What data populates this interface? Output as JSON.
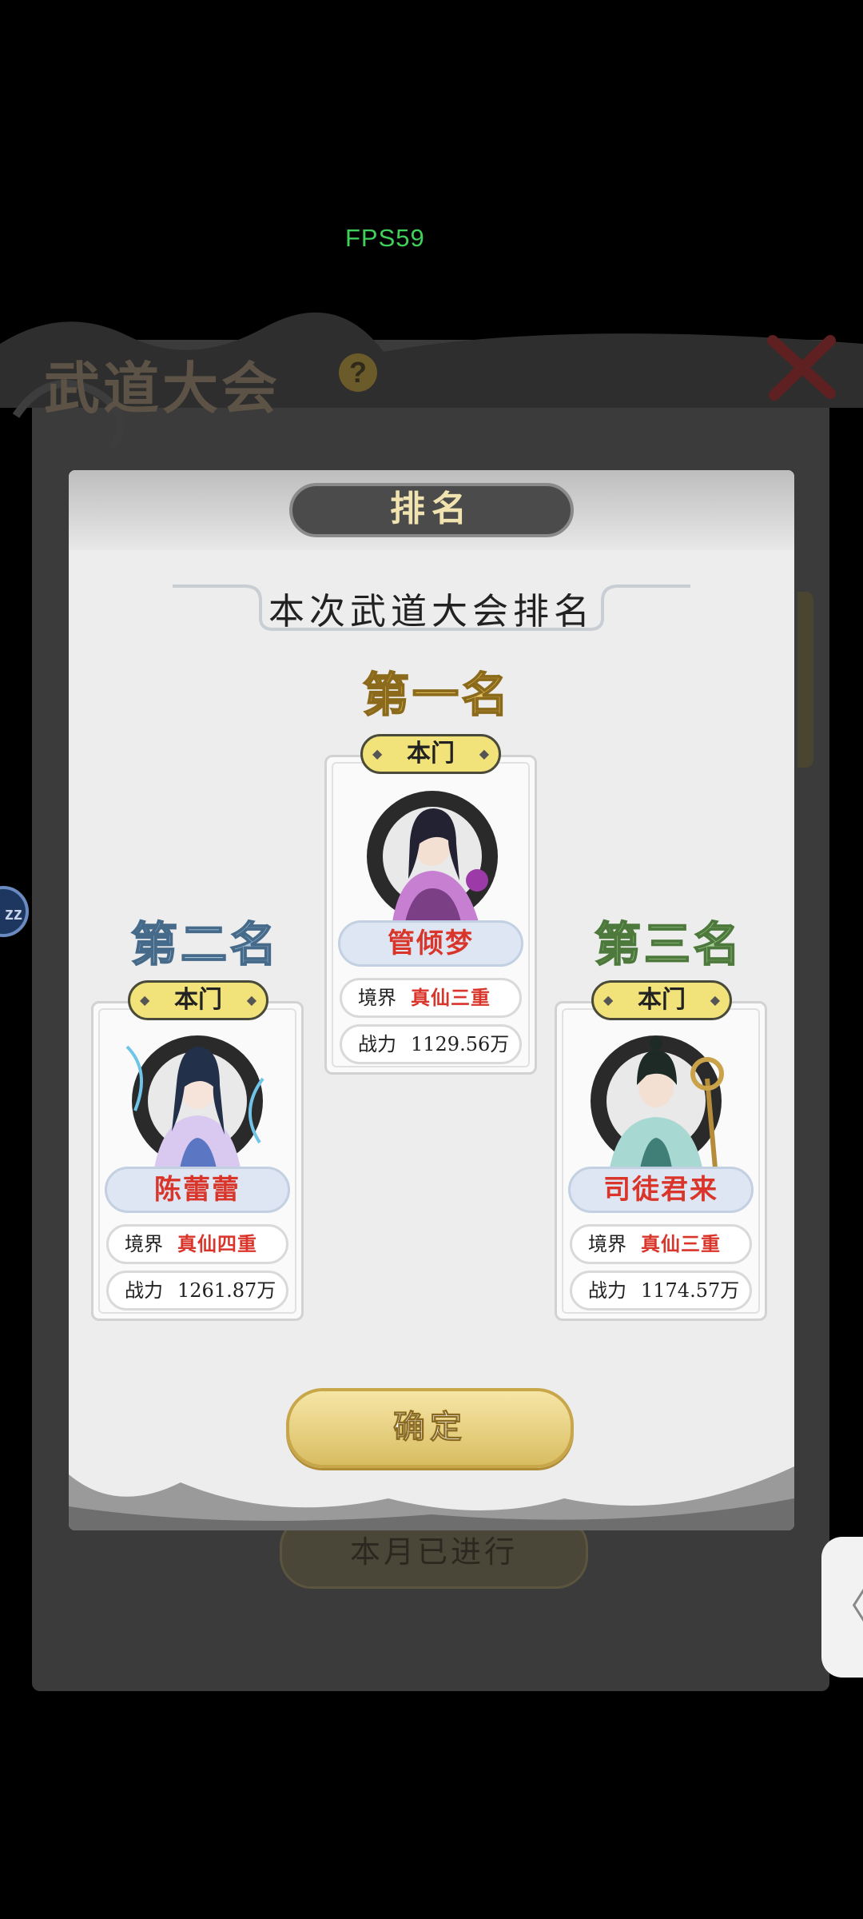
{
  "overlay": {
    "fps": "FPS59"
  },
  "background": {
    "title": "武道大会",
    "help_icon": "?",
    "month_status": "本月已进行",
    "side_bubble": "zz",
    "side_tab_icon": "〈"
  },
  "modal": {
    "header": "排名",
    "subtitle": "本次武道大会排名",
    "confirm": "确定"
  },
  "rankings": [
    {
      "rank": "第一名",
      "sect": "本门",
      "name": "管倾梦",
      "realm_label": "境界",
      "realm": "真仙三重",
      "power_label": "战力",
      "power": "1129.56万"
    },
    {
      "rank": "第二名",
      "sect": "本门",
      "name": "陈蕾蕾",
      "realm_label": "境界",
      "realm": "真仙四重",
      "power_label": "战力",
      "power": "1261.87万"
    },
    {
      "rank": "第三名",
      "sect": "本门",
      "name": "司徒君来",
      "realm_label": "境界",
      "realm": "真仙三重",
      "power_label": "战力",
      "power": "1174.57万"
    }
  ],
  "colors": {
    "rank1": "#e9c866",
    "rank2": "#a6c3d9",
    "rank3": "#a9d19a",
    "name_red": "#d9352b",
    "sect_badge": "#f1e27a",
    "confirm_gold": "#d9bd62"
  }
}
